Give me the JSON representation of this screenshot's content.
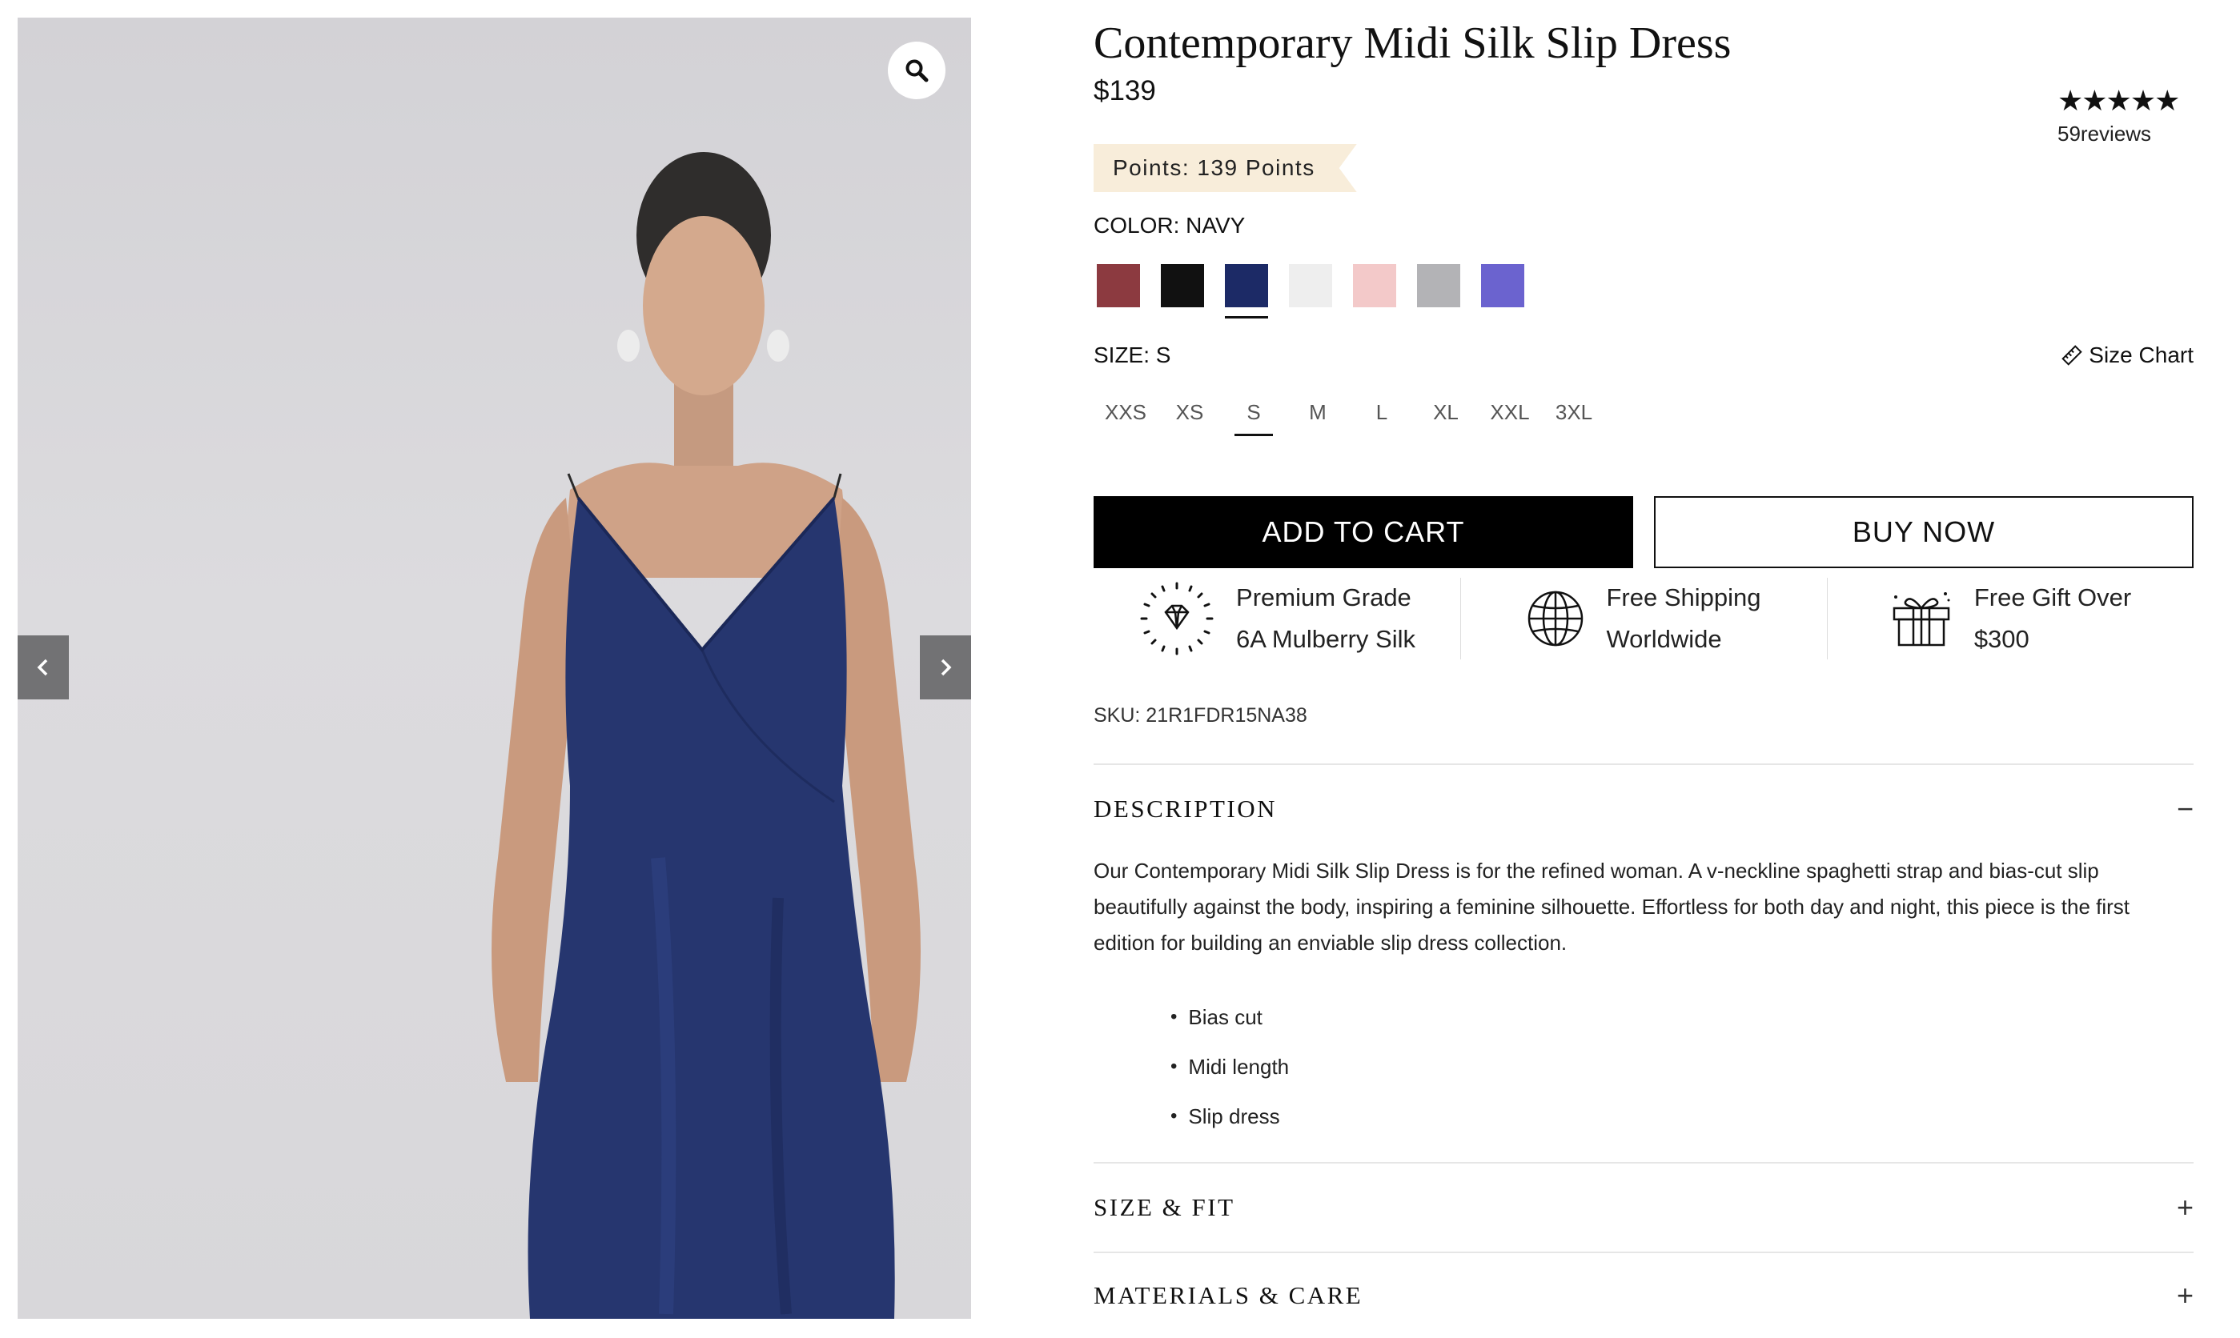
{
  "gallery": {
    "zoom_icon": "magnifier-icon",
    "prev_icon": "chevron-left-icon",
    "next_icon": "chevron-right-icon"
  },
  "product": {
    "title": "Contemporary Midi Silk Slip Dress",
    "price": "$139",
    "rating": {
      "stars": "★★★★★",
      "reviews": "59reviews",
      "value_of_5": 5
    },
    "points": "Points: 139 Points",
    "color_label": "COLOR: NAVY",
    "colors": [
      {
        "name": "burgundy",
        "hex": "#8c3a40"
      },
      {
        "name": "black",
        "hex": "#111111"
      },
      {
        "name": "navy",
        "hex": "#1c2a66",
        "selected": true
      },
      {
        "name": "white",
        "hex": "#eeeeee"
      },
      {
        "name": "pink",
        "hex": "#f3c9c9"
      },
      {
        "name": "grey",
        "hex": "#b3b3b6"
      },
      {
        "name": "purple",
        "hex": "#6b63cf"
      }
    ],
    "size_label": "SIZE: S",
    "size_chart_label": "Size Chart",
    "sizes": [
      "XXS",
      "XS",
      "S",
      "M",
      "L",
      "XL",
      "XXL",
      "3XL"
    ],
    "selected_size": "S",
    "add_to_cart": "ADD TO CART",
    "buy_now": "BUY NOW",
    "features": [
      {
        "icon": "diamond-icon",
        "line1": "Premium Grade",
        "line2": "6A Mulberry Silk"
      },
      {
        "icon": "globe-icon",
        "line1": "Free Shipping",
        "line2": "Worldwide"
      },
      {
        "icon": "gift-icon",
        "line1": "Free Gift Over",
        "line2": "$300"
      }
    ],
    "sku": "SKU: 21R1FDR15NA38"
  },
  "accordion": {
    "description": {
      "title": "DESCRIPTION",
      "icon": "−",
      "text": "Our Contemporary Midi Silk Slip Dress is for the refined woman. A v-neckline spaghetti strap and bias-cut slip beautifully against the body, inspiring a feminine silhouette. Effortless for both day and night, this piece is the first edition for building an enviable slip dress collection.",
      "bullets": [
        "Bias cut",
        "Midi length",
        "Slip dress"
      ]
    },
    "size_fit": {
      "title": "SIZE & FIT",
      "icon": "+"
    },
    "materials_care": {
      "title": "MATERIALS & CARE",
      "icon": "+"
    }
  },
  "colors": {
    "accent": "#000000",
    "points_bg": "#f8edda",
    "divider": "#e6e6e6"
  }
}
